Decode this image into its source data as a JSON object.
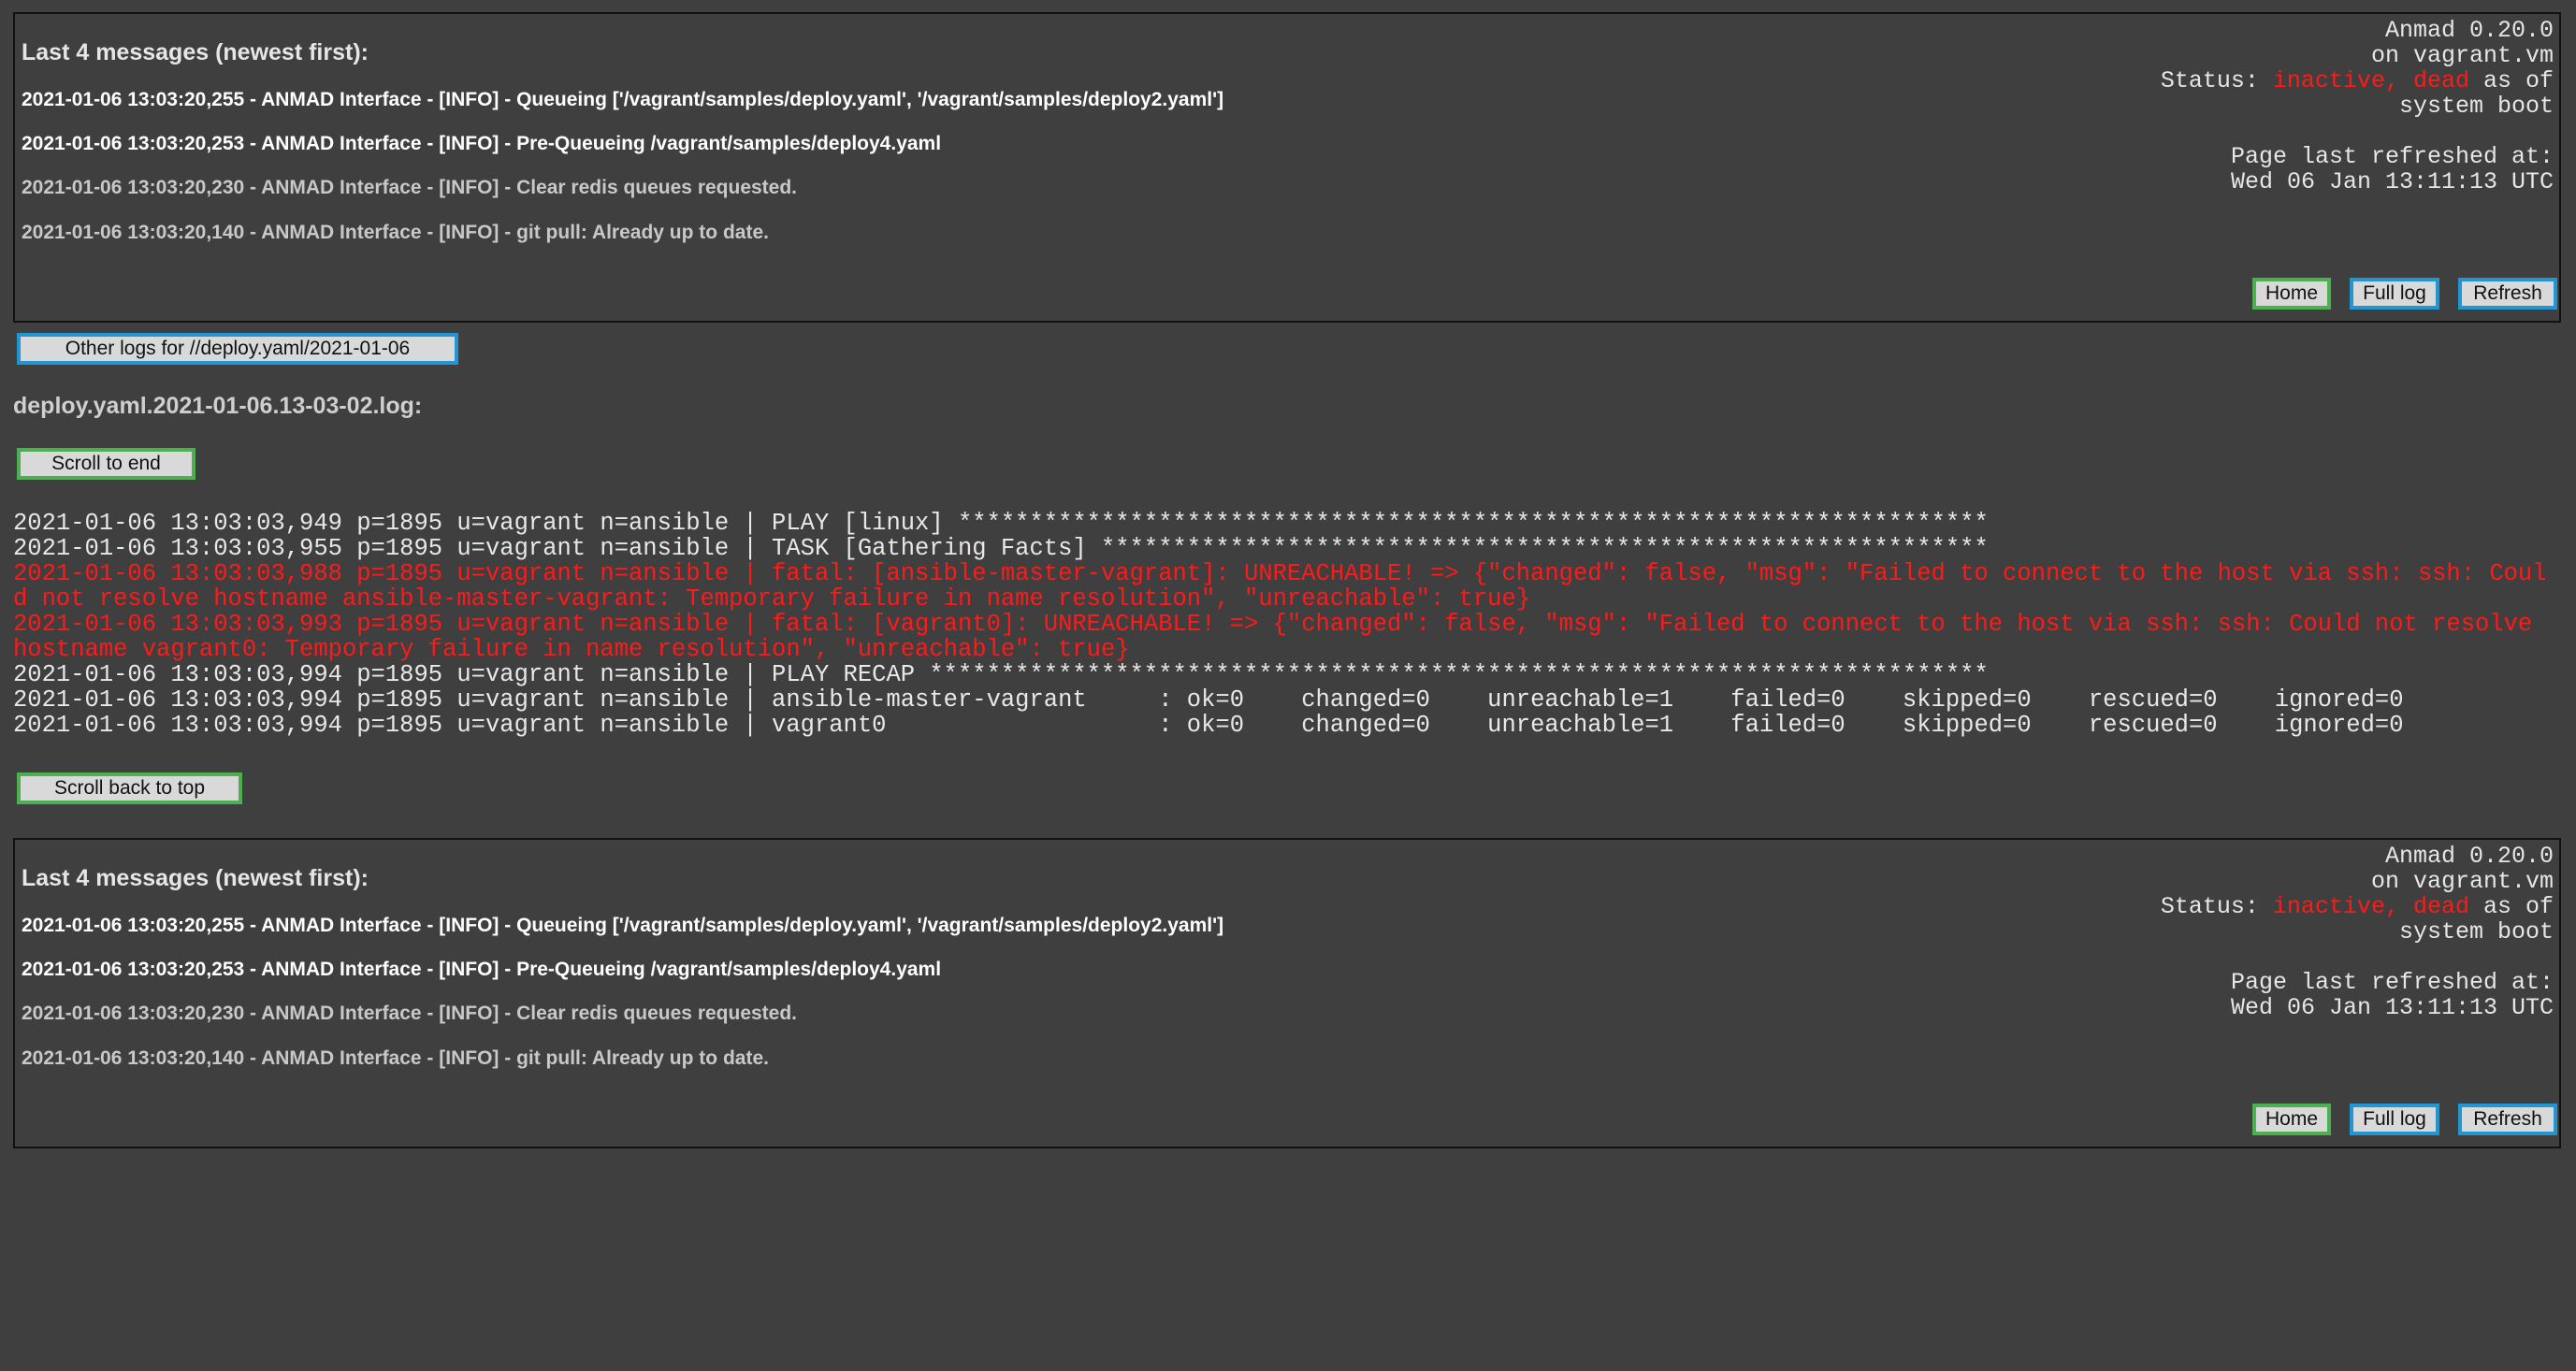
{
  "panel": {
    "heading": "Last 4 messages (newest first):",
    "messages": [
      {
        "text": "2021-01-06 13:03:20,255 - ANMAD Interface - [INFO] - Queueing ['/vagrant/samples/deploy.yaml', '/vagrant/samples/deploy2.yaml']",
        "emphasis": "bold"
      },
      {
        "text": "2021-01-06 13:03:20,253 - ANMAD Interface - [INFO] - Pre-Queueing /vagrant/samples/deploy4.yaml",
        "emphasis": "bold"
      },
      {
        "text": "2021-01-06 13:03:20,230 - ANMAD Interface - [INFO] - Clear redis queues requested.",
        "emphasis": "normal"
      },
      {
        "text": "2021-01-06 13:03:20,140 - ANMAD Interface - [INFO] - git pull: Already up to date.",
        "emphasis": "normal"
      }
    ],
    "version": "Anmad 0.20.0",
    "host": "on vagrant.vm",
    "status_label": "Status:",
    "status_value": "inactive, dead",
    "status_suffix": "as of",
    "status_since": "system boot",
    "refreshed_label": "Page last refreshed at:",
    "refreshed_time": "Wed 06 Jan 13:11:13 UTC",
    "buttons": {
      "home": "Home",
      "full_log": "Full log",
      "refresh": "Refresh"
    }
  },
  "other_logs_button": "Other logs for //deploy.yaml/2021-01-06",
  "log_title": "deploy.yaml.2021-01-06.13-03-02.log:",
  "scroll_end_button": "Scroll to end",
  "scroll_top_button": "Scroll back to top",
  "log_lines": [
    {
      "text": "2021-01-06 13:03:03,949 p=1895 u=vagrant n=ansible | PLAY [linux] ************************************************************************",
      "level": "normal"
    },
    {
      "text": "2021-01-06 13:03:03,955 p=1895 u=vagrant n=ansible | TASK [Gathering Facts] **************************************************************",
      "level": "normal"
    },
    {
      "text": "2021-01-06 13:03:03,988 p=1895 u=vagrant n=ansible | fatal: [ansible-master-vagrant]: UNREACHABLE! => {\"changed\": false, \"msg\": \"Failed to connect to the host via ssh: ssh: Could not resolve hostname ansible-master-vagrant: Temporary failure in name resolution\", \"unreachable\": true}",
      "level": "error"
    },
    {
      "text": "2021-01-06 13:03:03,993 p=1895 u=vagrant n=ansible | fatal: [vagrant0]: UNREACHABLE! => {\"changed\": false, \"msg\": \"Failed to connect to the host via ssh: ssh: Could not resolve hostname vagrant0: Temporary failure in name resolution\", \"unreachable\": true}",
      "level": "error"
    },
    {
      "text": "2021-01-06 13:03:03,994 p=1895 u=vagrant n=ansible | PLAY RECAP **************************************************************************",
      "level": "normal"
    },
    {
      "text": "2021-01-06 13:03:03,994 p=1895 u=vagrant n=ansible | ansible-master-vagrant     : ok=0    changed=0    unreachable=1    failed=0    skipped=0    rescued=0    ignored=0",
      "level": "normal"
    },
    {
      "text": "2021-01-06 13:03:03,994 p=1895 u=vagrant n=ansible | vagrant0                   : ok=0    changed=0    unreachable=1    failed=0    skipped=0    rescued=0    ignored=0",
      "level": "normal"
    }
  ],
  "colors": {
    "background": "#3f3f3f",
    "status_error": "#ff1a1a",
    "button_green_border": "#4caf50",
    "button_blue_border": "#2196d3"
  }
}
